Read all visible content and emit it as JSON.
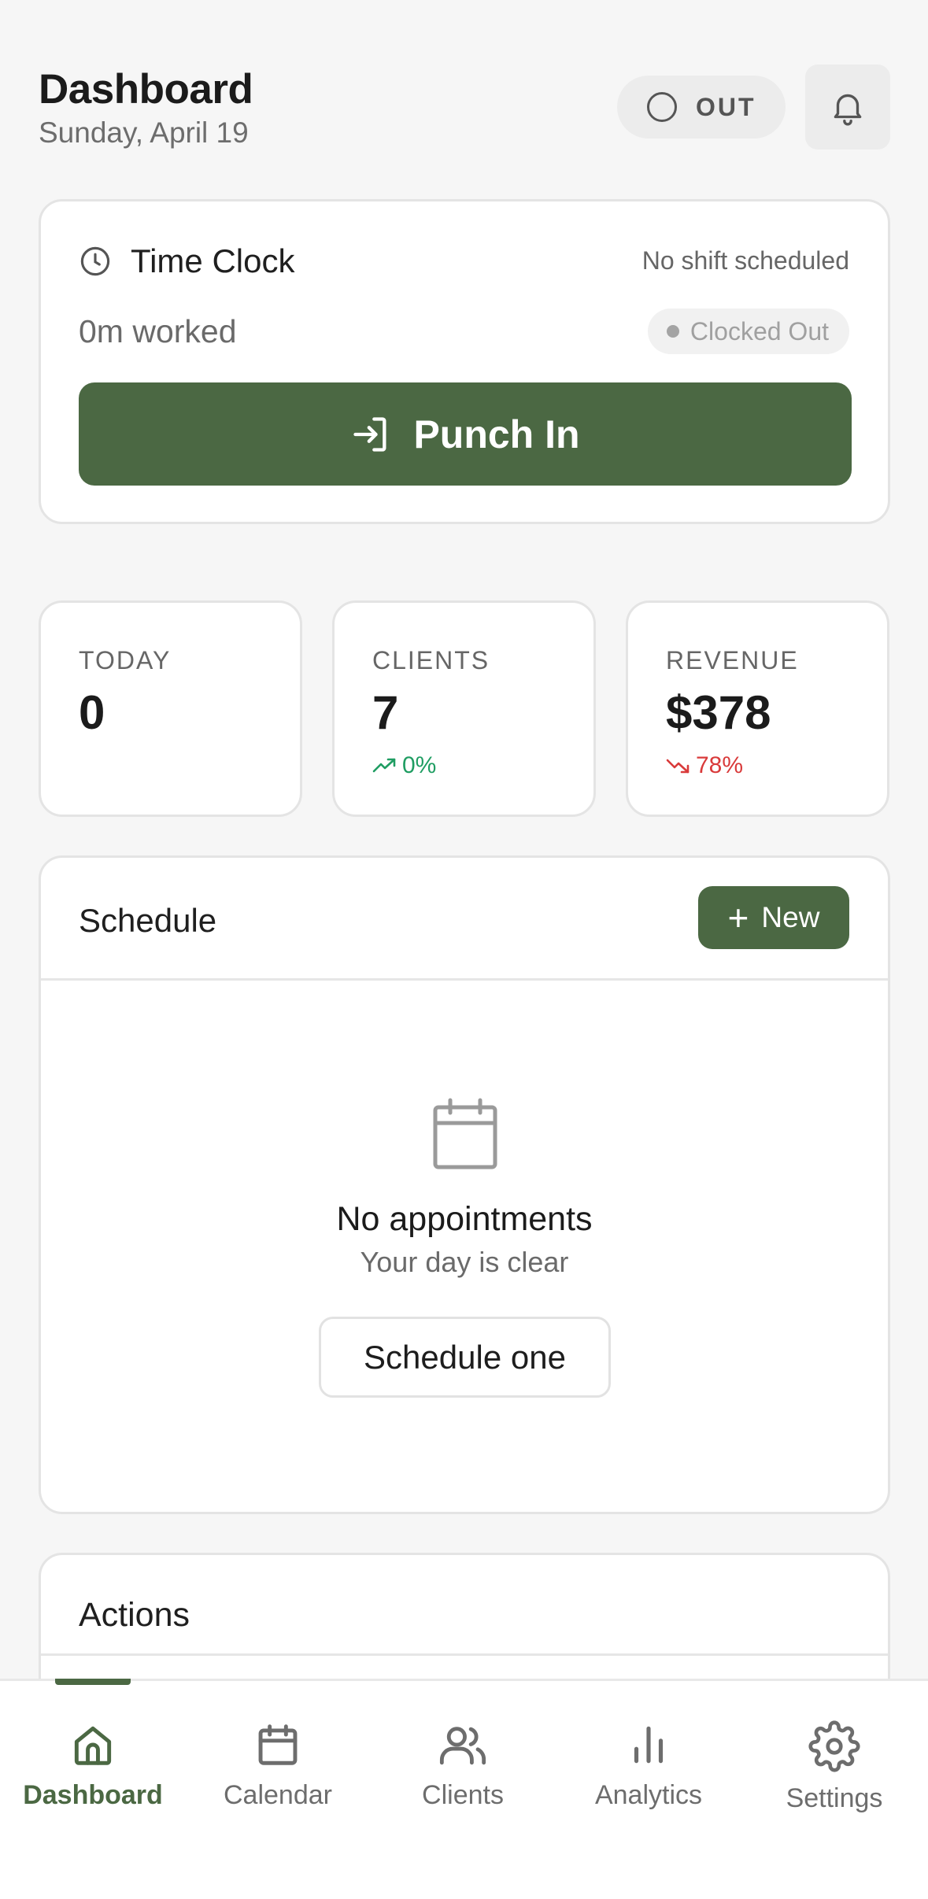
{
  "header": {
    "title": "Dashboard",
    "date": "Sunday, April 19",
    "status_label": "OUT",
    "bell_icon": "bell-icon"
  },
  "time_clock": {
    "title": "Time Clock",
    "shift_status": "No shift scheduled",
    "worked": "0m worked",
    "badge": "Clocked Out",
    "punch_label": "Punch In",
    "icons": [
      "clock-icon",
      "login-arrow-icon"
    ]
  },
  "stats": [
    {
      "label": "TODAY",
      "value": "0",
      "trend": "",
      "trend_dir": ""
    },
    {
      "label": "CLIENTS",
      "value": "7",
      "trend": "0%",
      "trend_dir": "up"
    },
    {
      "label": "REVENUE",
      "value": "$378",
      "trend": "78%",
      "trend_dir": "down"
    }
  ],
  "schedule": {
    "title": "Schedule",
    "new_label": "New",
    "empty_title": "No appointments",
    "empty_sub": "Your day is clear",
    "cta": "Schedule one"
  },
  "actions": {
    "title": "Actions"
  },
  "nav": {
    "items": [
      {
        "label": "Dashboard",
        "icon": "home-icon",
        "active": true
      },
      {
        "label": "Calendar",
        "icon": "calendar-icon",
        "active": false
      },
      {
        "label": "Clients",
        "icon": "users-icon",
        "active": false
      },
      {
        "label": "Analytics",
        "icon": "bar-chart-icon",
        "active": false
      },
      {
        "label": "Settings",
        "icon": "gear-icon",
        "active": false
      }
    ]
  },
  "colors": {
    "accent": "#4b6843",
    "background": "#f6f6f6",
    "trend_up": "#1f9d62",
    "trend_down": "#d93a3a"
  }
}
